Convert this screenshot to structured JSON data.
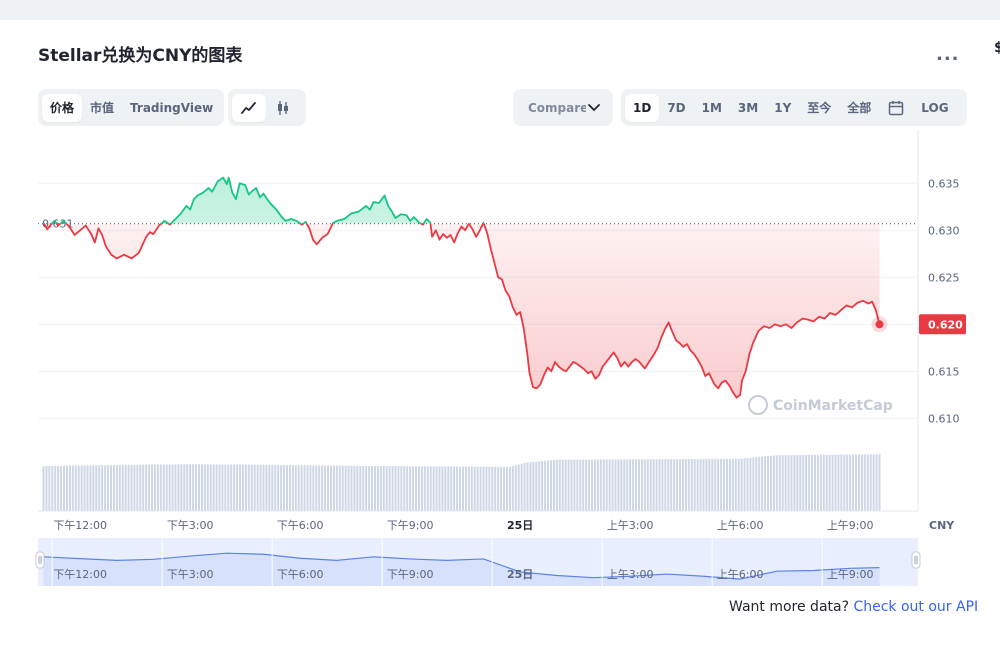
{
  "header": {
    "title": "Stellar兑换为CNY的图表",
    "more_label": "...",
    "side_fragment": "$"
  },
  "toolbar": {
    "type_tabs": [
      {
        "label": "价格",
        "active": true
      },
      {
        "label": "市值",
        "active": false
      },
      {
        "label": "TradingView",
        "active": false
      }
    ],
    "icon_tabs": [
      {
        "icon": "line-chart-icon",
        "active": true
      },
      {
        "icon": "candlestick-icon",
        "active": false
      }
    ],
    "compare_label": "Compare with",
    "ranges": [
      {
        "label": "1D",
        "active": true
      },
      {
        "label": "7D",
        "active": false
      },
      {
        "label": "1M",
        "active": false
      },
      {
        "label": "3M",
        "active": false
      },
      {
        "label": "1Y",
        "active": false
      },
      {
        "label": "至今",
        "active": false
      },
      {
        "label": "全部",
        "active": false
      }
    ],
    "calendar_icon": "calendar-icon",
    "log_label": "LOG"
  },
  "footer": {
    "prompt": "Want more data? ",
    "link": "Check out our API"
  },
  "chart_data": {
    "type": "area",
    "y_ticks": [
      0.61,
      0.615,
      0.62,
      0.625,
      0.63,
      0.635
    ],
    "y_tick_labels": [
      "0.610",
      "0.615",
      "0.620",
      "0.625",
      "0.630",
      "0.635"
    ],
    "ylim": [
      0.6061,
      0.6396
    ],
    "currency_label": "CNY",
    "reference_value": 0.6307,
    "reference_label": "0.631",
    "last_value": 0.62,
    "last_value_label": "0.620",
    "watermark": "CoinMarketCap",
    "x_tick_labels": [
      "下午12:00",
      "下午3:00",
      "下午6:00",
      "下午9:00",
      "25日",
      "上午3:00",
      "上午6:00",
      "上午9:00"
    ],
    "x_tick_hours": [
      12,
      15,
      18,
      21,
      24,
      27,
      30,
      33
    ],
    "x_range_hours": [
      10.85,
      34.85
    ],
    "colors": {
      "up": "#16c784",
      "down": "#ea3943",
      "grid": "#eff2f5",
      "volume": "#cfd6e4",
      "navigator": "#5b83e6"
    },
    "series": [
      {
        "values": [
          [
            11.0,
            0.6308
          ],
          [
            11.1,
            0.6301
          ],
          [
            11.2,
            0.6306
          ],
          [
            11.3,
            0.631
          ],
          [
            11.4,
            0.6305
          ],
          [
            11.55,
            0.631
          ],
          [
            11.7,
            0.6304
          ],
          [
            11.85,
            0.6295
          ],
          [
            12.0,
            0.63
          ],
          [
            12.15,
            0.6305
          ],
          [
            12.3,
            0.6296
          ],
          [
            12.4,
            0.6287
          ],
          [
            12.5,
            0.6302
          ],
          [
            12.6,
            0.6295
          ],
          [
            12.7,
            0.6283
          ],
          [
            12.85,
            0.6274
          ],
          [
            13.0,
            0.627
          ],
          [
            13.2,
            0.6274
          ],
          [
            13.4,
            0.627
          ],
          [
            13.6,
            0.6276
          ],
          [
            13.8,
            0.6293
          ],
          [
            13.9,
            0.6298
          ],
          [
            14.0,
            0.6296
          ],
          [
            14.15,
            0.6305
          ],
          [
            14.3,
            0.631
          ],
          [
            14.45,
            0.6306
          ],
          [
            14.6,
            0.6312
          ],
          [
            14.75,
            0.6318
          ],
          [
            14.9,
            0.6326
          ],
          [
            15.0,
            0.6322
          ],
          [
            15.1,
            0.6333
          ],
          [
            15.2,
            0.6337
          ],
          [
            15.35,
            0.634
          ],
          [
            15.5,
            0.6345
          ],
          [
            15.6,
            0.6341
          ],
          [
            15.75,
            0.6352
          ],
          [
            15.9,
            0.6356
          ],
          [
            16.0,
            0.6349
          ],
          [
            16.05,
            0.6356
          ],
          [
            16.15,
            0.634
          ],
          [
            16.25,
            0.6333
          ],
          [
            16.35,
            0.635
          ],
          [
            16.5,
            0.6348
          ],
          [
            16.6,
            0.6338
          ],
          [
            16.7,
            0.6342
          ],
          [
            16.8,
            0.6345
          ],
          [
            16.9,
            0.6335
          ],
          [
            17.0,
            0.6339
          ],
          [
            17.1,
            0.6333
          ],
          [
            17.2,
            0.6328
          ],
          [
            17.35,
            0.6322
          ],
          [
            17.5,
            0.6314
          ],
          [
            17.6,
            0.631
          ],
          [
            17.75,
            0.6312
          ],
          [
            17.9,
            0.631
          ],
          [
            18.05,
            0.6306
          ],
          [
            18.15,
            0.6309
          ],
          [
            18.25,
            0.6302
          ],
          [
            18.35,
            0.629
          ],
          [
            18.45,
            0.6285
          ],
          [
            18.6,
            0.6292
          ],
          [
            18.75,
            0.6296
          ],
          [
            18.9,
            0.6308
          ],
          [
            19.0,
            0.631
          ],
          [
            19.2,
            0.6312
          ],
          [
            19.4,
            0.6318
          ],
          [
            19.6,
            0.632
          ],
          [
            19.8,
            0.6326
          ],
          [
            19.9,
            0.6322
          ],
          [
            20.0,
            0.633
          ],
          [
            20.15,
            0.6329
          ],
          [
            20.3,
            0.6337
          ],
          [
            20.4,
            0.6326
          ],
          [
            20.5,
            0.632
          ],
          [
            20.6,
            0.6313
          ],
          [
            20.75,
            0.6317
          ],
          [
            20.9,
            0.6316
          ],
          [
            21.0,
            0.631
          ],
          [
            21.1,
            0.6314
          ],
          [
            21.25,
            0.6308
          ],
          [
            21.35,
            0.6306
          ],
          [
            21.45,
            0.6312
          ],
          [
            21.55,
            0.6308
          ],
          [
            21.6,
            0.6293
          ],
          [
            21.7,
            0.63
          ],
          [
            21.8,
            0.629
          ],
          [
            21.9,
            0.6296
          ],
          [
            22.0,
            0.6292
          ],
          [
            22.1,
            0.6295
          ],
          [
            22.2,
            0.6287
          ],
          [
            22.3,
            0.6297
          ],
          [
            22.4,
            0.6304
          ],
          [
            22.5,
            0.63
          ],
          [
            22.6,
            0.6307
          ],
          [
            22.7,
            0.6301
          ],
          [
            22.8,
            0.6293
          ],
          [
            22.9,
            0.63
          ],
          [
            23.0,
            0.6308
          ],
          [
            23.1,
            0.6297
          ],
          [
            23.2,
            0.628
          ],
          [
            23.3,
            0.6265
          ],
          [
            23.4,
            0.625
          ],
          [
            23.5,
            0.6248
          ],
          [
            23.6,
            0.6236
          ],
          [
            23.7,
            0.623
          ],
          [
            23.8,
            0.6218
          ],
          [
            23.9,
            0.621
          ],
          [
            24.0,
            0.6213
          ],
          [
            24.1,
            0.6195
          ],
          [
            24.2,
            0.6167
          ],
          [
            24.25,
            0.6149
          ],
          [
            24.35,
            0.6133
          ],
          [
            24.45,
            0.6132
          ],
          [
            24.55,
            0.6136
          ],
          [
            24.65,
            0.6146
          ],
          [
            24.75,
            0.6154
          ],
          [
            24.85,
            0.615
          ],
          [
            24.95,
            0.616
          ],
          [
            25.05,
            0.6155
          ],
          [
            25.15,
            0.6152
          ],
          [
            25.25,
            0.615
          ],
          [
            25.35,
            0.6155
          ],
          [
            25.45,
            0.616
          ],
          [
            25.55,
            0.6158
          ],
          [
            25.65,
            0.6155
          ],
          [
            25.75,
            0.6152
          ],
          [
            25.85,
            0.6148
          ],
          [
            25.95,
            0.615
          ],
          [
            26.05,
            0.6142
          ],
          [
            26.15,
            0.6146
          ],
          [
            26.25,
            0.6155
          ],
          [
            26.35,
            0.616
          ],
          [
            26.45,
            0.6165
          ],
          [
            26.55,
            0.617
          ],
          [
            26.65,
            0.6164
          ],
          [
            26.75,
            0.6155
          ],
          [
            26.85,
            0.616
          ],
          [
            26.95,
            0.6155
          ],
          [
            27.05,
            0.616
          ],
          [
            27.15,
            0.6163
          ],
          [
            27.25,
            0.616
          ],
          [
            27.4,
            0.6153
          ],
          [
            27.55,
            0.6162
          ],
          [
            27.65,
            0.6168
          ],
          [
            27.75,
            0.6175
          ],
          [
            27.85,
            0.6186
          ],
          [
            27.95,
            0.6195
          ],
          [
            28.05,
            0.6202
          ],
          [
            28.15,
            0.6192
          ],
          [
            28.25,
            0.6183
          ],
          [
            28.35,
            0.618
          ],
          [
            28.45,
            0.6176
          ],
          [
            28.55,
            0.6179
          ],
          [
            28.65,
            0.6172
          ],
          [
            28.75,
            0.6168
          ],
          [
            28.85,
            0.6162
          ],
          [
            28.95,
            0.6155
          ],
          [
            29.05,
            0.6145
          ],
          [
            29.15,
            0.6148
          ],
          [
            29.25,
            0.614
          ],
          [
            29.3,
            0.6136
          ],
          [
            29.4,
            0.6132
          ],
          [
            29.5,
            0.6138
          ],
          [
            29.6,
            0.614
          ],
          [
            29.7,
            0.6135
          ],
          [
            29.8,
            0.6128
          ],
          [
            29.9,
            0.6122
          ],
          [
            30.0,
            0.6125
          ],
          [
            30.05,
            0.614
          ],
          [
            30.15,
            0.615
          ],
          [
            30.25,
            0.6168
          ],
          [
            30.35,
            0.618
          ],
          [
            30.5,
            0.6193
          ],
          [
            30.65,
            0.6198
          ],
          [
            30.8,
            0.6196
          ],
          [
            30.95,
            0.62
          ],
          [
            31.1,
            0.6198
          ],
          [
            31.25,
            0.62
          ],
          [
            31.4,
            0.6196
          ],
          [
            31.55,
            0.6202
          ],
          [
            31.7,
            0.6206
          ],
          [
            31.85,
            0.6205
          ],
          [
            32.0,
            0.6203
          ],
          [
            32.15,
            0.6208
          ],
          [
            32.3,
            0.6206
          ],
          [
            32.45,
            0.6212
          ],
          [
            32.6,
            0.621
          ],
          [
            32.75,
            0.6215
          ],
          [
            32.9,
            0.622
          ],
          [
            33.05,
            0.6218
          ],
          [
            33.2,
            0.6223
          ],
          [
            33.35,
            0.6225
          ],
          [
            33.5,
            0.6222
          ],
          [
            33.6,
            0.6224
          ],
          [
            33.7,
            0.6215
          ],
          [
            33.8,
            0.62
          ]
        ]
      }
    ],
    "volume": [
      [
        11.0,
        0.5
      ],
      [
        15.0,
        0.52
      ],
      [
        20.0,
        0.5
      ],
      [
        23.7,
        0.49
      ],
      [
        24.2,
        0.54
      ],
      [
        25.0,
        0.57
      ],
      [
        30.0,
        0.58
      ],
      [
        31.0,
        0.62
      ],
      [
        33.8,
        0.63
      ]
    ],
    "navigator": [
      [
        11.0,
        0.7
      ],
      [
        12.0,
        0.65
      ],
      [
        13.0,
        0.6
      ],
      [
        14.0,
        0.63
      ],
      [
        15.0,
        0.72
      ],
      [
        16.0,
        0.8
      ],
      [
        17.0,
        0.77
      ],
      [
        18.0,
        0.66
      ],
      [
        19.0,
        0.6
      ],
      [
        20.0,
        0.7
      ],
      [
        21.0,
        0.64
      ],
      [
        22.0,
        0.6
      ],
      [
        23.0,
        0.64
      ],
      [
        24.0,
        0.28
      ],
      [
        25.0,
        0.18
      ],
      [
        26.0,
        0.12
      ],
      [
        27.0,
        0.16
      ],
      [
        28.0,
        0.22
      ],
      [
        29.0,
        0.16
      ],
      [
        30.0,
        0.08
      ],
      [
        31.0,
        0.3
      ],
      [
        32.0,
        0.32
      ],
      [
        33.0,
        0.38
      ],
      [
        33.8,
        0.4
      ]
    ]
  }
}
